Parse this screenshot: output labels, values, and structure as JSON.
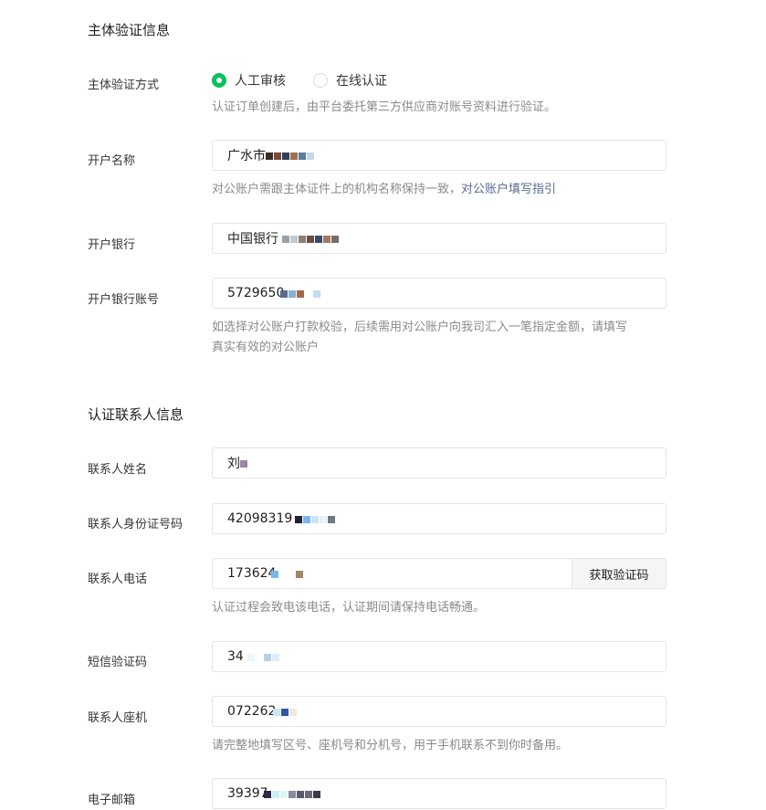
{
  "section_subject": {
    "title": "主体验证信息",
    "method_label": "主体验证方式",
    "method_options": [
      "人工审核",
      "在线认证"
    ],
    "method_selected": "人工审核",
    "method_hint": "认证订单创建后，由平台委托第三方供应商对账号资料进行验证。",
    "account_name_label": "开户名称",
    "account_name_value": "广水市",
    "account_name_hint": "对公账户需跟主体证件上的机构名称保持一致，",
    "account_name_hint_link": "对公账户填写指引",
    "bank_label": "开户银行",
    "bank_value": "中国银行",
    "bank_account_label": "开户银行账号",
    "bank_account_value": "5729650",
    "bank_account_hint_line1": "如选择对公账户打款校验，后续需用对公账户向我司汇入一笔指定金额，请填写",
    "bank_account_hint_line2": "真实有效的对公账户"
  },
  "section_contact": {
    "title": "认证联系人信息",
    "name_label": "联系人姓名",
    "name_value": "刘",
    "id_label": "联系人身份证号码",
    "id_value": "42098319",
    "phone_label": "联系人电话",
    "phone_value": "173624",
    "get_code_button": "获取验证码",
    "phone_hint": "认证过程会致电该电话，认证期间请保持电话畅通。",
    "sms_label": "短信验证码",
    "sms_value": "34",
    "landline_label": "联系人座机",
    "landline_value": "072262",
    "landline_hint": "请完整地填写区号、座机号和分机号，用于手机联系不到你时备用。",
    "email_label": "电子邮箱",
    "email_value": "39397"
  },
  "colors": {
    "accent": "#07c160",
    "link": "#576b95",
    "hint": "#8a8a8a"
  }
}
